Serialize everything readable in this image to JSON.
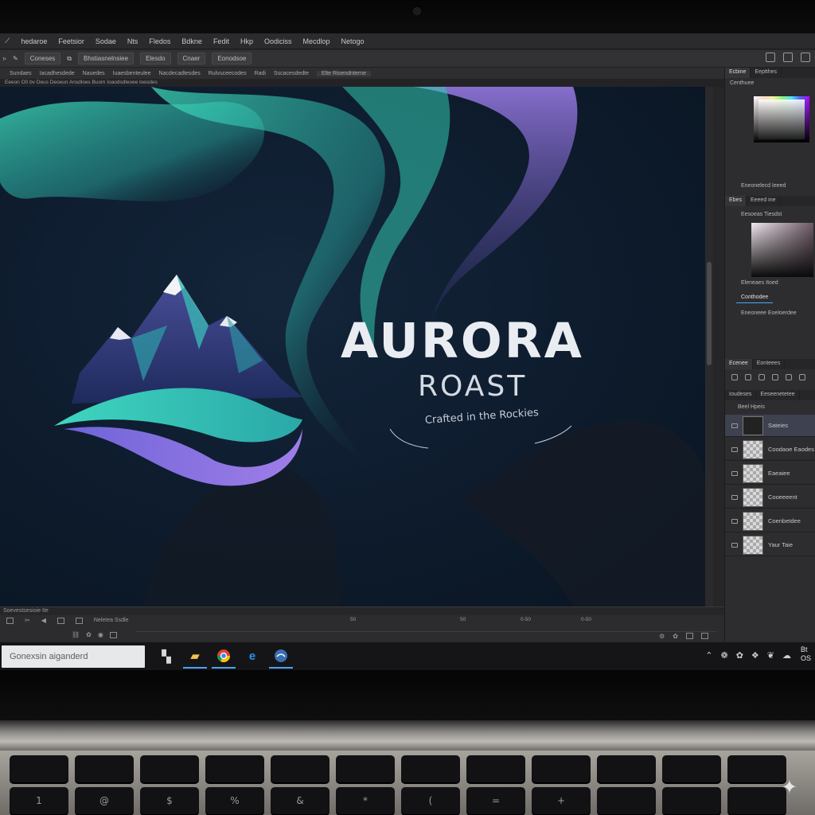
{
  "menu": {
    "items": [
      "hedaroe",
      "Feetsior",
      "Sodae",
      "Nts",
      "Fledos",
      "Bdkne",
      "Fedit",
      "Hkp",
      "Oodiciss",
      "Mecdlop",
      "Netogo"
    ]
  },
  "options_bar": {
    "chips": [
      "Coneses",
      "Bhstiasnelnsiee",
      "Elesdo",
      "Cnaer",
      "Eonodsoe"
    ]
  },
  "doc_tabs": [
    "Sundaes",
    "Iacadhesdede",
    "Nauedes",
    "Iuaesbenteulee",
    "Nacdecadtesdes",
    "Rulvuceecodes",
    "Radi",
    "Sscacesdedte",
    "Elte Rioendnterne"
  ],
  "info_line": "Eeeon O0 bv Deus  Deoeun Ansdloes  Buom Ioaodsdleoee loeodes",
  "canvas": {
    "title": "AURORA",
    "subtitle": "ROAST",
    "tagline": "Crafted in the Rockies"
  },
  "timeline": {
    "header": "Soevestsesioie Ite",
    "marks": [
      "50",
      "50",
      "0-50",
      "0-50"
    ],
    "label": "Neletea Ssdle"
  },
  "right_panel": {
    "tabs_top": [
      "Ecbine",
      "Eeptthes"
    ],
    "label_top": "Centhuee",
    "label_top_bottom": "Eneonelecd Ieeed",
    "tabs_mid": [
      "Ebes",
      "Eeeed ine"
    ],
    "label_mid": "Eesoeas Tiesdst",
    "label_mid_bottom": "Eleneaes Itoed",
    "section": "Conthodee",
    "section_sub": "Eneoneee Eoeloerdee",
    "tabs_layers": [
      "Ecenee",
      "Eonteees"
    ],
    "layers_tabs2": [
      "Ioudeses",
      "Eeseenetetee"
    ],
    "layers_header": "Beel Hpeis",
    "layers": [
      {
        "name": "Sateies",
        "selected": true
      },
      {
        "name": "Coodaoe Eaodes",
        "selected": false
      },
      {
        "name": "Eaeaiee",
        "selected": false
      },
      {
        "name": "Cooeeeent",
        "selected": false
      },
      {
        "name": "Coenbetdee",
        "selected": false
      },
      {
        "name": "Yaur Taie",
        "selected": false
      }
    ]
  },
  "taskbar": {
    "search_placeholder": "Gonexsin aiganderd",
    "apps": [
      "file-explorer-icon",
      "chrome-icon",
      "edge-icon",
      "app-icon"
    ],
    "clock": "Bt OS"
  },
  "keyboard": {
    "row1": [
      "",
      "",
      "",
      "",
      "",
      "",
      "",
      "",
      "",
      "",
      "",
      "",
      ""
    ],
    "row2": [
      "1",
      "@",
      "$",
      "%",
      "&",
      "*",
      "(",
      "=",
      "+",
      "",
      "",
      "",
      ""
    ]
  },
  "colors": {
    "canvas_bg": "#0d1b2c",
    "aurora_teal": "#38d3b4",
    "aurora_violet": "#8f6fe0",
    "mountain_dark": "#2a2f6a",
    "title_white": "#e9edf2"
  }
}
